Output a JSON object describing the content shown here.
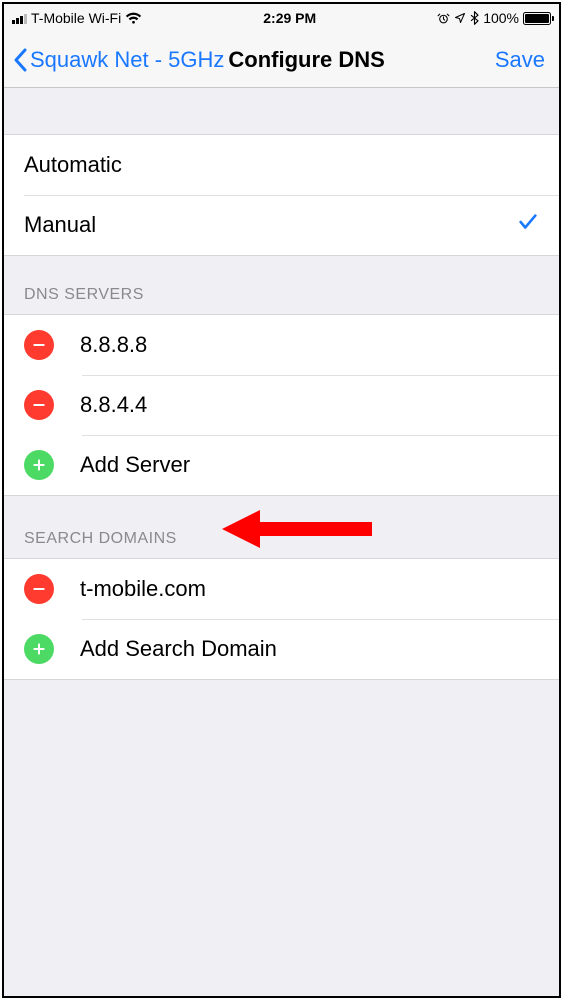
{
  "status": {
    "carrier": "T-Mobile Wi-Fi",
    "time": "2:29 PM",
    "battery_pct": "100%"
  },
  "nav": {
    "back_label": "Squawk Net - 5GHz",
    "title": "Configure DNS",
    "save_label": "Save"
  },
  "mode": {
    "automatic_label": "Automatic",
    "manual_label": "Manual",
    "selected": "manual"
  },
  "dns_section": {
    "header": "DNS SERVERS",
    "servers": [
      "8.8.8.8",
      "8.8.4.4"
    ],
    "add_label": "Add Server"
  },
  "search_section": {
    "header": "SEARCH DOMAINS",
    "domains": [
      "t-mobile.com"
    ],
    "add_label": "Add Search Domain"
  }
}
